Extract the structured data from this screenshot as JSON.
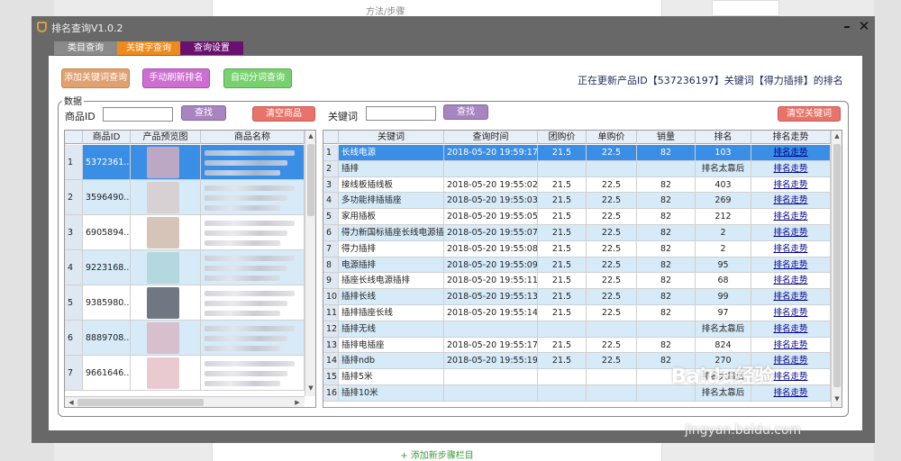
{
  "background": {
    "tab_label": "方法/步骤",
    "add_step_label": "+ 添加新步骤栏目"
  },
  "window": {
    "title": "排名查询V1.0.2",
    "minimize": "–",
    "close": "✕"
  },
  "tabs": [
    "类目查询",
    "关键字查询",
    "查询设置"
  ],
  "toolbar": {
    "add_keyword_query": "添加关键词查询",
    "manual_refresh": "手动刷新排名",
    "auto_split_query": "自动分词查询"
  },
  "status": "正在更新产品ID【537236197】关键词【得力插排】的排名",
  "data_group": {
    "label": "数据",
    "product_id_label": "商品ID",
    "product_id_value": "",
    "find_button": "查找",
    "clear_products_button": "清空商品",
    "keyword_label": "关键词",
    "keyword_value": "",
    "keyword_find_button": "查找",
    "clear_keywords_button": "清空关键词"
  },
  "product_grid": {
    "headers": [
      "商品ID",
      "产品预览图",
      "商品名称"
    ],
    "rows": [
      {
        "num": "1",
        "id": "5372361..."
      },
      {
        "num": "2",
        "id": "3596490..."
      },
      {
        "num": "3",
        "id": "6905894..."
      },
      {
        "num": "4",
        "id": "9223168..."
      },
      {
        "num": "5",
        "id": "9385980..."
      },
      {
        "num": "6",
        "id": "8889708..."
      },
      {
        "num": "7",
        "id": "9661646..."
      }
    ]
  },
  "keyword_grid": {
    "headers": [
      "关键词",
      "查询时间",
      "团购价",
      "单购价",
      "销量",
      "排名",
      "排名走势"
    ],
    "trend_link": "排名走势",
    "rows": [
      {
        "num": "1",
        "keyword": "长线电源",
        "time": "2018-05-20 19:59:17",
        "group_price": "21.5",
        "single_price": "22.5",
        "sales": "82",
        "rank": "103"
      },
      {
        "num": "2",
        "keyword": "插排",
        "time": "",
        "group_price": "",
        "single_price": "",
        "sales": "",
        "rank": "排名太靠后"
      },
      {
        "num": "3",
        "keyword": "接线板插线板",
        "time": "2018-05-20 19:55:02",
        "group_price": "21.5",
        "single_price": "22.5",
        "sales": "82",
        "rank": "403"
      },
      {
        "num": "4",
        "keyword": "多功能排插插座",
        "time": "2018-05-20 19:55:03",
        "group_price": "21.5",
        "single_price": "22.5",
        "sales": "82",
        "rank": "269"
      },
      {
        "num": "5",
        "keyword": "家用插板",
        "time": "2018-05-20 19:55:05",
        "group_price": "21.5",
        "single_price": "22.5",
        "sales": "82",
        "rank": "212"
      },
      {
        "num": "6",
        "keyword": "得力新国标插座长线电源插",
        "time": "2018-05-20 19:55:07",
        "group_price": "21.5",
        "single_price": "22.5",
        "sales": "82",
        "rank": "2"
      },
      {
        "num": "7",
        "keyword": "得力插排",
        "time": "2018-05-20 19:55:08",
        "group_price": "21.5",
        "single_price": "22.5",
        "sales": "82",
        "rank": "2"
      },
      {
        "num": "8",
        "keyword": "电源插排",
        "time": "2018-05-20 19:55:09",
        "group_price": "21.5",
        "single_price": "22.5",
        "sales": "82",
        "rank": "95"
      },
      {
        "num": "9",
        "keyword": "插座长线电源插排",
        "time": "2018-05-20 19:55:11",
        "group_price": "21.5",
        "single_price": "22.5",
        "sales": "82",
        "rank": "68"
      },
      {
        "num": "10",
        "keyword": "插排长线",
        "time": "2018-05-20 19:55:13",
        "group_price": "21.5",
        "single_price": "22.5",
        "sales": "82",
        "rank": "99"
      },
      {
        "num": "11",
        "keyword": "插排插座长线",
        "time": "2018-05-20 19:55:14",
        "group_price": "21.5",
        "single_price": "22.5",
        "sales": "82",
        "rank": "97"
      },
      {
        "num": "12",
        "keyword": "插排无线",
        "time": "",
        "group_price": "",
        "single_price": "",
        "sales": "",
        "rank": "排名太靠后"
      },
      {
        "num": "13",
        "keyword": "插排电插座",
        "time": "2018-05-20 19:55:17",
        "group_price": "21.5",
        "single_price": "22.5",
        "sales": "82",
        "rank": "824"
      },
      {
        "num": "14",
        "keyword": "插排ndb",
        "time": "2018-05-20 19:55:19",
        "group_price": "21.5",
        "single_price": "22.5",
        "sales": "82",
        "rank": "270"
      },
      {
        "num": "15",
        "keyword": "插排5米",
        "time": "",
        "group_price": "",
        "single_price": "",
        "sales": "",
        "rank": "排名太靠后"
      },
      {
        "num": "16",
        "keyword": "插排10米",
        "time": "",
        "group_price": "",
        "single_price": "",
        "sales": "",
        "rank": "排名太靠后"
      }
    ]
  },
  "watermark": {
    "brand": "Baidu经验",
    "url": "jingyan.baidu.com"
  }
}
